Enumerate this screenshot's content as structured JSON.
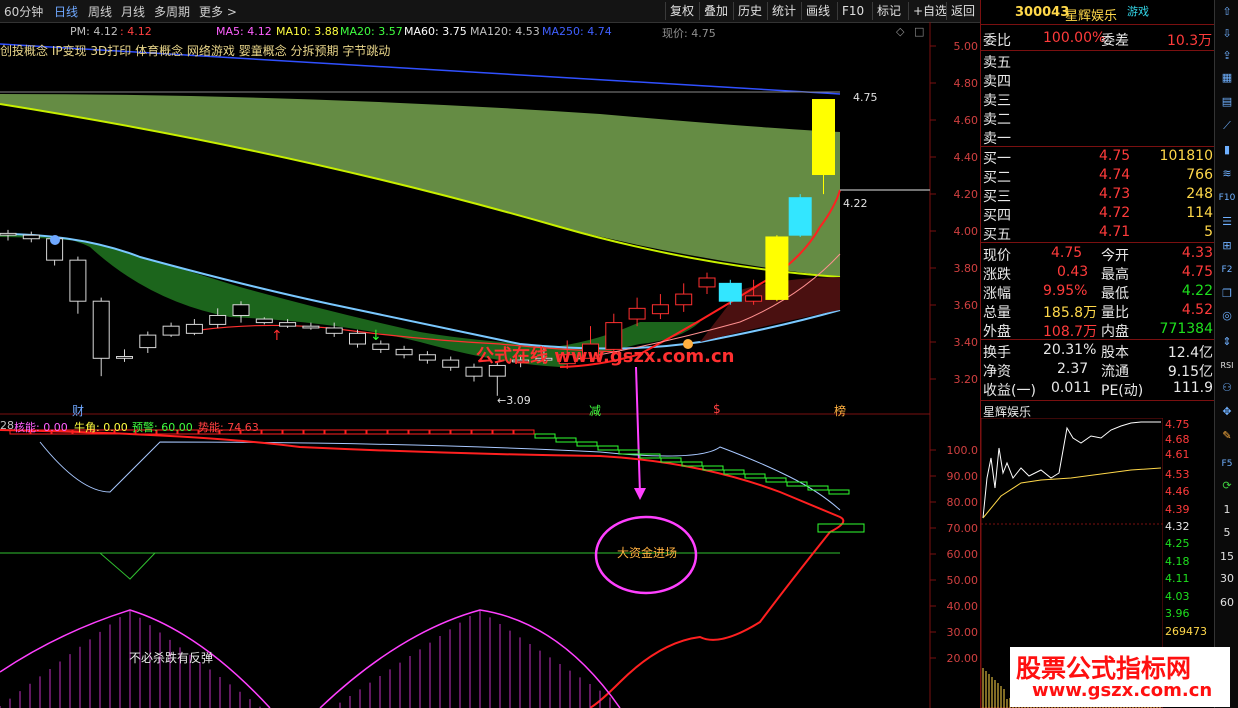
{
  "periods": [
    "60分钟",
    "日线",
    "周线",
    "月线",
    "多周期",
    "更多 >"
  ],
  "active_period": "日线",
  "toolbar": [
    "复权",
    "叠加",
    "历史",
    "统计",
    "画线",
    "F10",
    "标记",
    "+自选",
    "返回"
  ],
  "ma_legend": {
    "pm": "PM: 4.12",
    "pm2": ": 4.12",
    "ma5": "MA5: 4.12",
    "ma10": "MA10: 3.88",
    "ma20": "MA20: 3.57",
    "ma60": "MA60: 3.75",
    "ma120": "MA120: 4.53",
    "ma250": "MA250: 4.74",
    "current": "现价: 4.75"
  },
  "concepts": "创投概念 IP变现 3D打印 体育概念 网络游戏 婴童概念 分拆预期 字节跳动",
  "price_axis": [
    "5.00",
    "4.80",
    "4.60",
    "4.40",
    "4.20",
    "4.00",
    "3.80",
    "3.60",
    "3.40",
    "3.20"
  ],
  "price_labels": {
    "high": "4.75",
    "mid": "4.22",
    "low": "←3.09"
  },
  "markers": [
    "财",
    "减",
    "$",
    "榜"
  ],
  "watermark_chart": "公式在线 www.gszx.com.cn",
  "indicator_legend": {
    "prefix": "28",
    "heneng": "核能: 0.00",
    "niujiao": "牛角: 0.00",
    "yujing": "预警: 60.00",
    "shineng": "势能: 74.63"
  },
  "indicator_axis": [
    "100.0",
    "90.00",
    "80.00",
    "70.00",
    "60.00",
    "50.00",
    "40.00",
    "30.00",
    "20.00"
  ],
  "annotations": {
    "circle_text": "大资金进场",
    "bottom_text": "不必杀跌有反弹"
  },
  "stock": {
    "code": "300043",
    "name": "星辉娱乐",
    "tag": "游戏"
  },
  "weibi": {
    "label1": "委比",
    "value1": "100.00%",
    "label2": "委差",
    "value2": "10.3万"
  },
  "sell_levels": [
    "卖五",
    "卖四",
    "卖三",
    "卖二",
    "卖一"
  ],
  "buy_levels": [
    {
      "label": "买一",
      "price": "4.75",
      "vol": "101810"
    },
    {
      "label": "买二",
      "price": "4.74",
      "vol": "766"
    },
    {
      "label": "买三",
      "price": "4.73",
      "vol": "248"
    },
    {
      "label": "买四",
      "price": "4.72",
      "vol": "114"
    },
    {
      "label": "买五",
      "price": "4.71",
      "vol": "5"
    }
  ],
  "quote_rows": [
    {
      "l1": "现价",
      "v1": "4.75",
      "c1": "red",
      "l2": "今开",
      "v2": "4.33",
      "c2": "red"
    },
    {
      "l1": "涨跌",
      "v1": "0.43",
      "c1": "red",
      "l2": "最高",
      "v2": "4.75",
      "c2": "red"
    },
    {
      "l1": "涨幅",
      "v1": "9.95%",
      "c1": "red",
      "l2": "最低",
      "v2": "4.22",
      "c2": "green"
    },
    {
      "l1": "总量",
      "v1": "185.8万",
      "c1": "yellow",
      "l2": "量比",
      "v2": "4.52",
      "c2": "red"
    },
    {
      "l1": "外盘",
      "v1": "108.7万",
      "c1": "red",
      "l2": "内盘",
      "v2": "771384",
      "c2": "green"
    }
  ],
  "stat_rows": [
    {
      "l1": "换手",
      "v1": "20.31%",
      "l2": "股本",
      "v2": "12.4亿"
    },
    {
      "l1": "净资",
      "v1": "2.37",
      "l2": "流通",
      "v2": "9.15亿"
    },
    {
      "l1": "收益(一)",
      "v1": "0.011",
      "l2": "PE(动)",
      "v2": "111.9"
    }
  ],
  "mini_chart": {
    "title": "星辉娱乐",
    "axis": [
      "4.75",
      "4.68",
      "4.61",
      "4.53",
      "4.46",
      "4.39",
      "4.32",
      "4.25",
      "4.18",
      "4.11",
      "4.03",
      "3.96"
    ],
    "volume": "269473"
  },
  "side_numbers": [
    "1",
    "5",
    "15",
    "30",
    "60"
  ],
  "brand": {
    "line1": "股票公式指标网",
    "line2": "www.gszx.com.cn"
  },
  "chart_data": {
    "type": "candlestick",
    "candles": [
      {
        "o": 4.0,
        "h": 4.02,
        "l": 3.96,
        "c": 3.99,
        "up": false
      },
      {
        "o": 3.99,
        "h": 4.01,
        "l": 3.95,
        "c": 3.97,
        "up": false
      },
      {
        "o": 3.97,
        "h": 3.98,
        "l": 3.82,
        "c": 3.85,
        "up": false
      },
      {
        "o": 3.85,
        "h": 3.87,
        "l": 3.55,
        "c": 3.62,
        "up": false
      },
      {
        "o": 3.62,
        "h": 3.64,
        "l": 3.2,
        "c": 3.3,
        "up": false
      },
      {
        "o": 3.3,
        "h": 3.35,
        "l": 3.28,
        "c": 3.31,
        "up": false
      },
      {
        "o": 3.36,
        "h": 3.45,
        "l": 3.33,
        "c": 3.43,
        "up": false
      },
      {
        "o": 3.43,
        "h": 3.5,
        "l": 3.42,
        "c": 3.48,
        "up": false
      },
      {
        "o": 3.44,
        "h": 3.52,
        "l": 3.43,
        "c": 3.49,
        "up": false
      },
      {
        "o": 3.49,
        "h": 3.58,
        "l": 3.47,
        "c": 3.54,
        "up": false
      },
      {
        "o": 3.54,
        "h": 3.62,
        "l": 3.5,
        "c": 3.6,
        "up": false
      },
      {
        "o": 3.52,
        "h": 3.53,
        "l": 3.49,
        "c": 3.5,
        "up": false
      },
      {
        "o": 3.5,
        "h": 3.52,
        "l": 3.47,
        "c": 3.48,
        "up": false
      },
      {
        "o": 3.48,
        "h": 3.5,
        "l": 3.46,
        "c": 3.47,
        "up": false
      },
      {
        "o": 3.47,
        "h": 3.5,
        "l": 3.42,
        "c": 3.44,
        "up": false
      },
      {
        "o": 3.44,
        "h": 3.46,
        "l": 3.36,
        "c": 3.38,
        "up": false
      },
      {
        "o": 3.38,
        "h": 3.4,
        "l": 3.33,
        "c": 3.35,
        "up": false
      },
      {
        "o": 3.35,
        "h": 3.37,
        "l": 3.3,
        "c": 3.32,
        "up": false
      },
      {
        "o": 3.32,
        "h": 3.34,
        "l": 3.27,
        "c": 3.29,
        "up": false
      },
      {
        "o": 3.29,
        "h": 3.31,
        "l": 3.23,
        "c": 3.25,
        "up": false
      },
      {
        "o": 3.25,
        "h": 3.27,
        "l": 3.17,
        "c": 3.2,
        "up": false
      },
      {
        "o": 3.2,
        "h": 3.28,
        "l": 3.09,
        "c": 3.26,
        "up": false
      },
      {
        "o": 3.28,
        "h": 3.32,
        "l": 3.25,
        "c": 3.29,
        "up": false
      },
      {
        "o": 3.3,
        "h": 3.36,
        "l": 3.27,
        "c": 3.29,
        "up": false
      },
      {
        "o": 3.32,
        "h": 3.4,
        "l": 3.24,
        "c": 3.27,
        "up": true
      },
      {
        "o": 3.3,
        "h": 3.48,
        "l": 3.28,
        "c": 3.38,
        "up": true
      },
      {
        "o": 3.35,
        "h": 3.55,
        "l": 3.33,
        "c": 3.5,
        "up": true
      },
      {
        "o": 3.52,
        "h": 3.64,
        "l": 3.48,
        "c": 3.58,
        "up": true
      },
      {
        "o": 3.55,
        "h": 3.66,
        "l": 3.52,
        "c": 3.6,
        "up": true
      },
      {
        "o": 3.6,
        "h": 3.72,
        "l": 3.56,
        "c": 3.66,
        "up": true
      },
      {
        "o": 3.7,
        "h": 3.78,
        "l": 3.66,
        "c": 3.75,
        "up": true
      },
      {
        "o": 3.72,
        "h": 3.74,
        "l": 3.6,
        "c": 3.62,
        "up": false,
        "color": "#33e6ff"
      },
      {
        "o": 3.62,
        "h": 3.74,
        "l": 3.6,
        "c": 3.65,
        "up": true
      },
      {
        "o": 3.63,
        "h": 3.99,
        "l": 3.62,
        "c": 3.98,
        "up": true,
        "color": "#ffff00"
      },
      {
        "o": 4.2,
        "h": 4.22,
        "l": 3.98,
        "c": 3.99,
        "up": false,
        "color": "#33e6ff"
      },
      {
        "o": 4.33,
        "h": 4.75,
        "l": 4.22,
        "c": 4.75,
        "up": true,
        "color": "#ffff00"
      }
    ],
    "ylim": [
      3.1,
      5.05
    ]
  }
}
